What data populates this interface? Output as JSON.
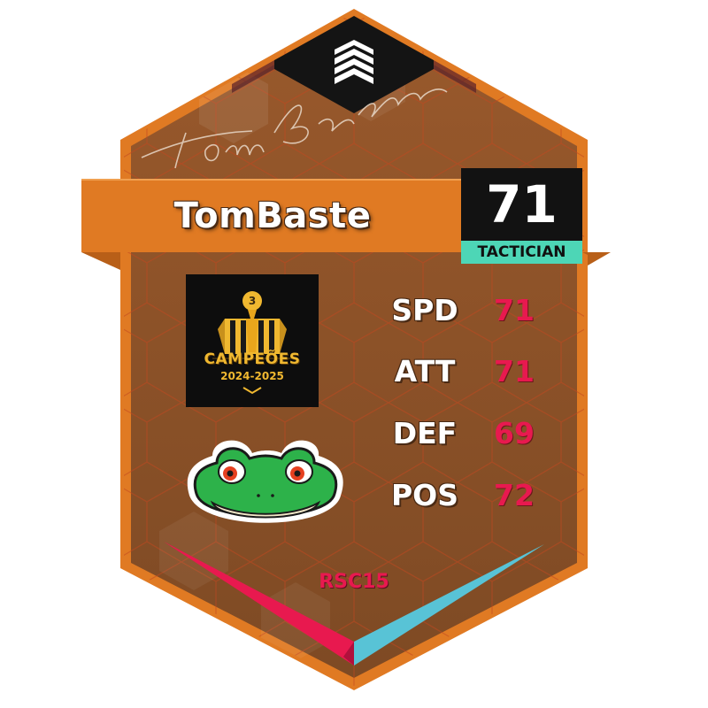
{
  "card": {
    "player_name": "TomBaste",
    "signature": "TomBaste",
    "rating": "71",
    "role": "TACTICIAN",
    "code": "RSC15",
    "brand_icon": "stacked-chevrons-logo-icon",
    "team_logo": {
      "icon": "trophy-logo-icon",
      "title": "CAMPEÕES",
      "subtitle": "2024-2025",
      "badge_number": "3"
    },
    "mascot_icon": "frog-face-icon"
  },
  "stats": [
    {
      "label": "SPD",
      "value": "71"
    },
    {
      "label": "ATT",
      "value": "71"
    },
    {
      "label": "DEF",
      "value": "69"
    },
    {
      "label": "POS",
      "value": "72"
    }
  ],
  "colors": {
    "frame": "#e07a23",
    "panel": "#8a5027",
    "stat_value": "#e8194f",
    "role_badge": "#4dd6b6",
    "accent_red": "#e8194f",
    "accent_cyan": "#58c3d6"
  }
}
